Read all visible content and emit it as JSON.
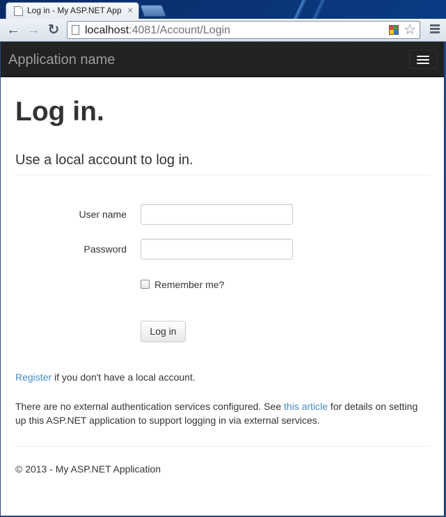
{
  "browser": {
    "tab": {
      "title": "Log in - My ASP.NET Application",
      "favicon": "page-icon",
      "close_icon": "×"
    },
    "toolbar": {
      "back_icon": "←",
      "forward_icon": "→",
      "reload_icon": "↻",
      "url_host": "localhost",
      "url_path": ":4081/Account/Login",
      "bookmark_icon": "☆",
      "extension_icon": "color-palette-icon",
      "menu_icon": "hamburger-menu-icon"
    }
  },
  "navbar": {
    "brand": "Application name",
    "toggle_icon": "hamburger-icon",
    "background": "#222222",
    "brand_color": "#9d9d9d"
  },
  "main": {
    "title": "Log in.",
    "subtitle": "Use a local account to log in.",
    "form": {
      "username_label": "User name",
      "username_value": "",
      "password_label": "Password",
      "password_value": "",
      "remember_label": "Remember me?",
      "remember_checked": false,
      "submit_label": "Log in"
    },
    "register": {
      "link_text": "Register",
      "suffix": " if you don't have a local account."
    },
    "external": {
      "prefix": "There are no external authentication services configured. See ",
      "link_text": "this article",
      "suffix": " for details on setting up this ASP.NET application to support logging in via external services."
    },
    "footer": "© 2013 - My ASP.NET Application",
    "link_color": "#428bca"
  }
}
